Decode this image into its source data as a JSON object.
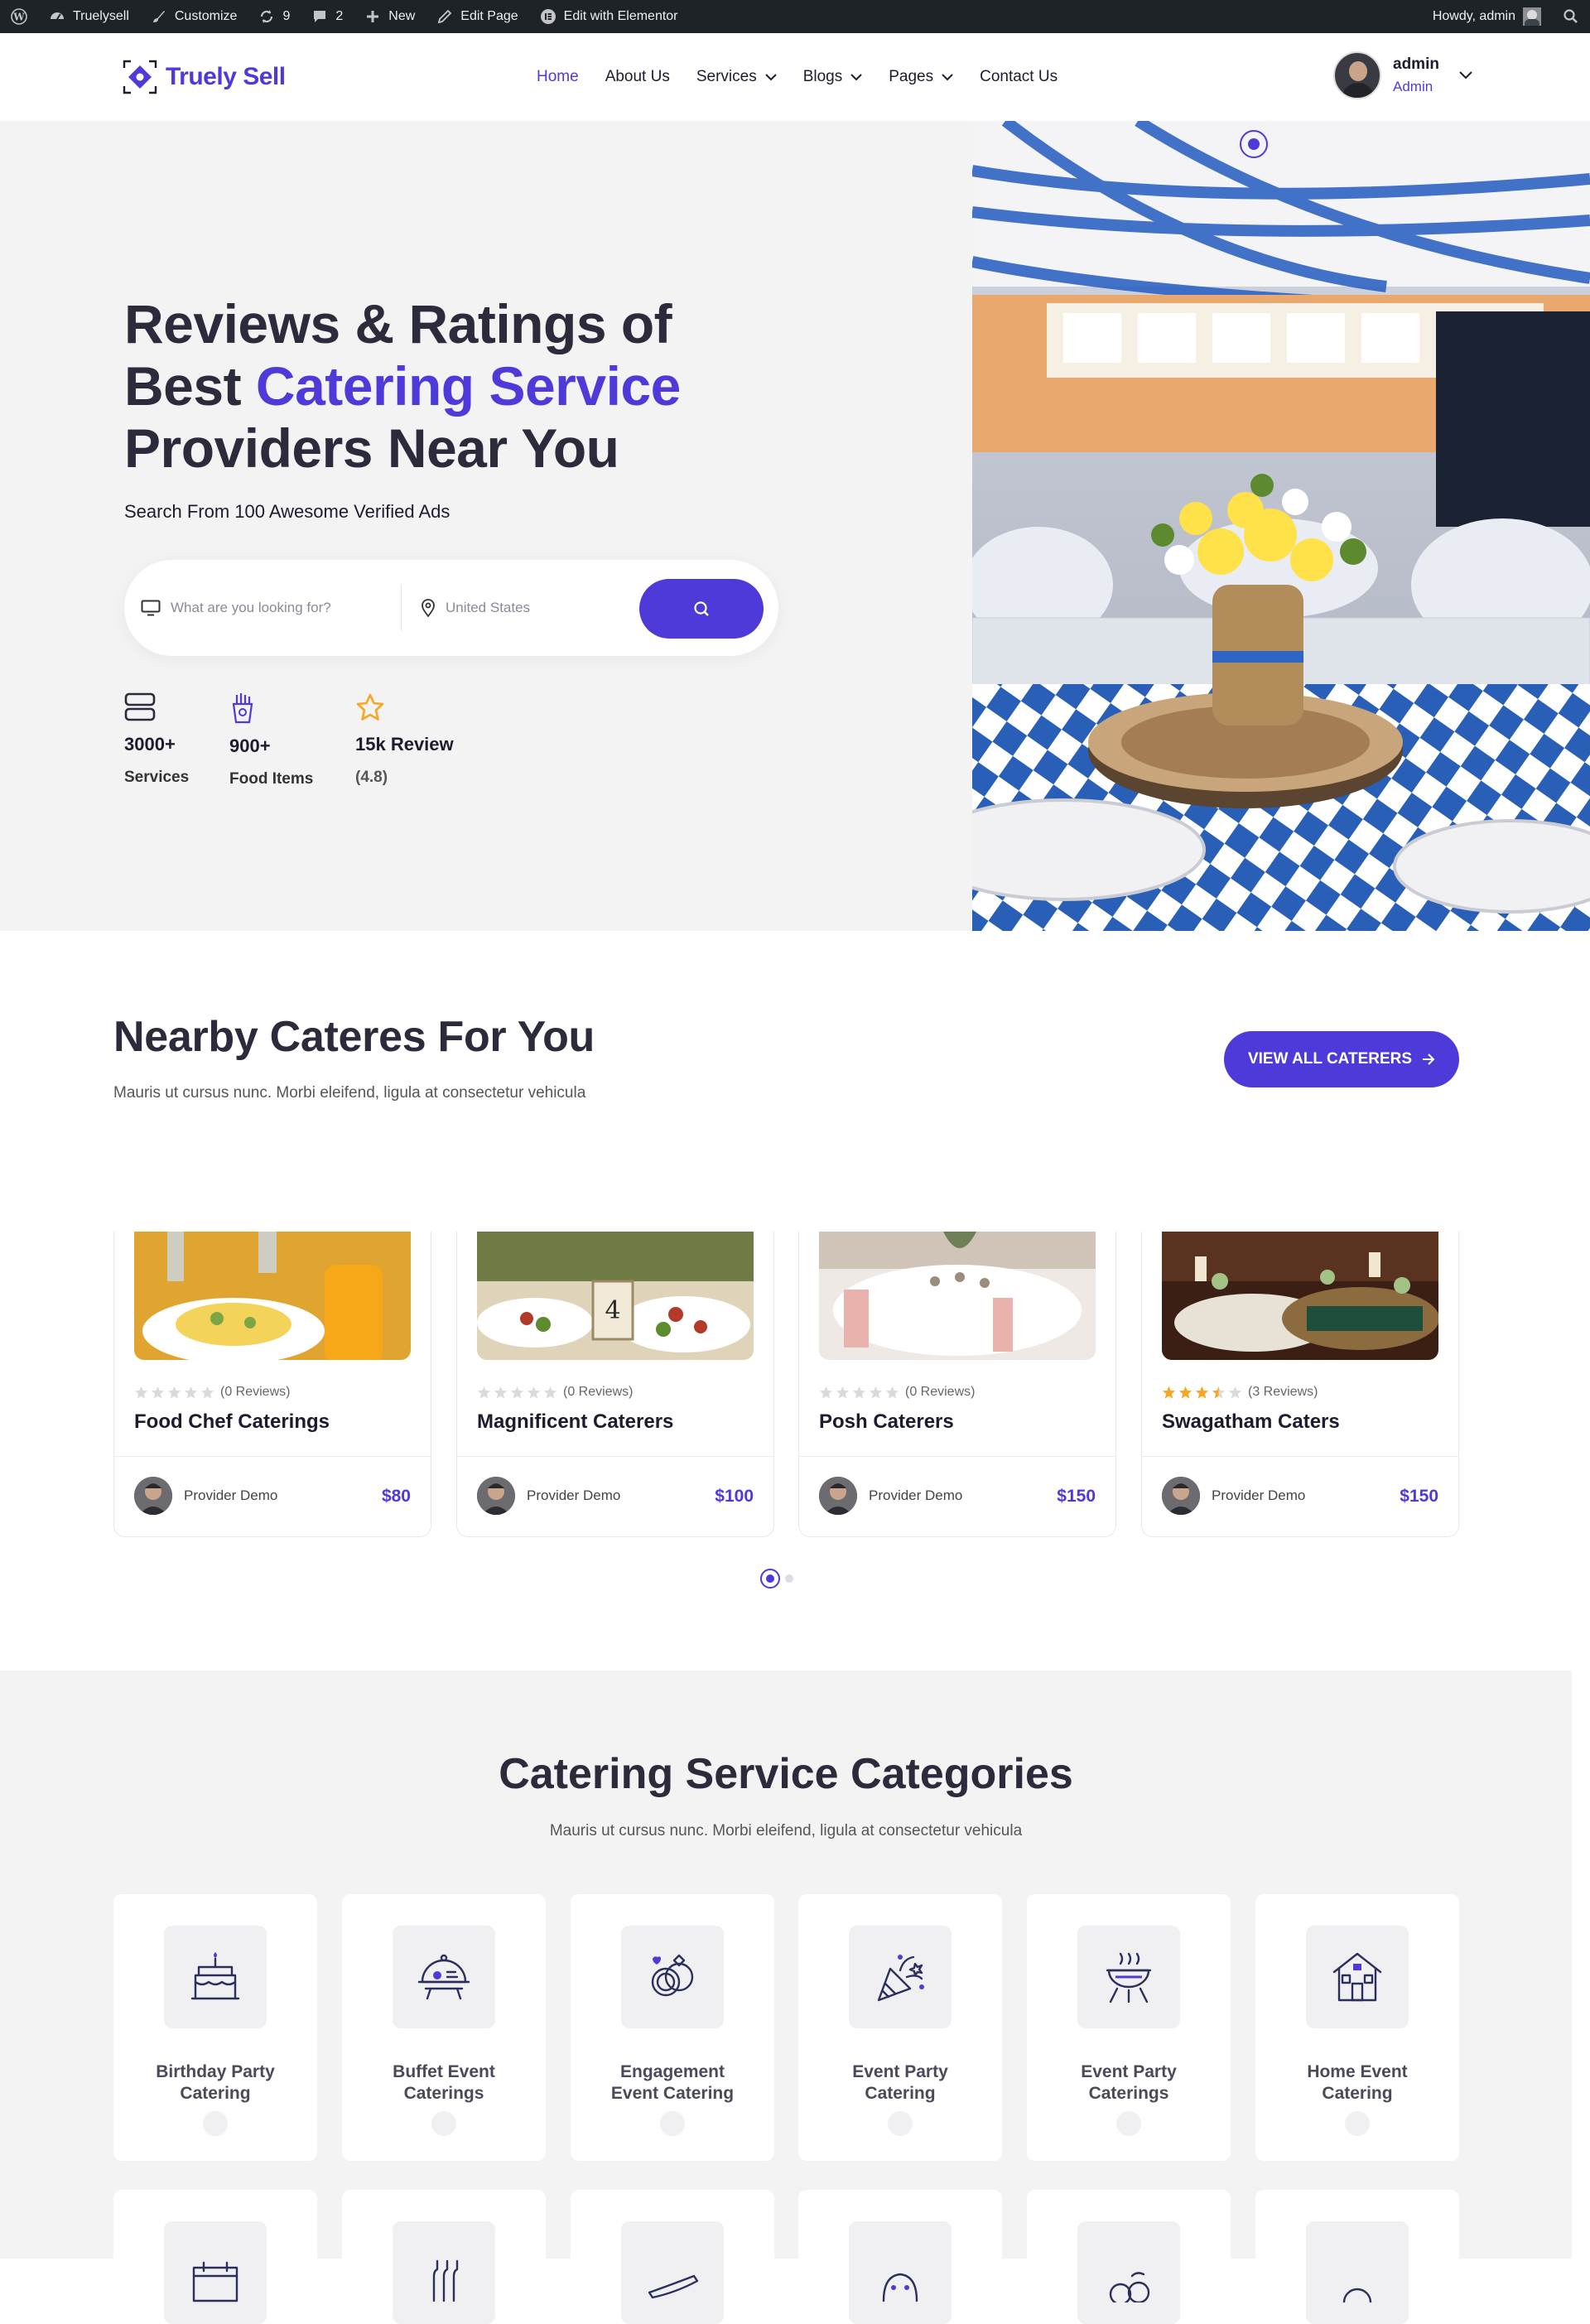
{
  "admin_bar": {
    "site_name": "Truelysell",
    "customize": "Customize",
    "updates": "9",
    "comments": "2",
    "new": "New",
    "edit_page": "Edit Page",
    "edit_elementor": "Edit with Elementor",
    "howdy": "Howdy, admin"
  },
  "header": {
    "logo": "Truely Sell",
    "nav": [
      "Home",
      "About Us",
      "Services",
      "Blogs",
      "Pages",
      "Contact Us"
    ],
    "user_name": "admin",
    "user_role": "Admin"
  },
  "hero": {
    "title_line1": "Reviews & Ratings of",
    "title_best": "Best",
    "title_accent": "Catering Service",
    "title_line3": "Providers Near You",
    "subtitle": "Search From 100 Awesome Verified Ads",
    "search_placeholder": "What are you looking for?",
    "location_placeholder": "United States",
    "stats": [
      {
        "value": "3000+",
        "label": "Services",
        "icon": "server-icon"
      },
      {
        "value": "900+",
        "label": "Food Items",
        "icon": "fries-icon"
      },
      {
        "value": "15k Review",
        "label": "(4.8)",
        "icon": "star-icon"
      }
    ]
  },
  "nearby": {
    "title": "Nearby Cateres For You",
    "subtitle": "Mauris ut cursus nunc. Morbi eleifend, ligula at consectetur vehicula",
    "button": "VIEW ALL CATERERS",
    "cards": [
      {
        "title": "Food Chef Caterings",
        "reviews": "(0 Reviews)",
        "rating": 0,
        "provider": "Provider Demo",
        "price": "$80"
      },
      {
        "title": "Magnificent Caterers",
        "reviews": "(0 Reviews)",
        "rating": 0,
        "provider": "Provider Demo",
        "price": "$100"
      },
      {
        "title": "Posh Caterers",
        "reviews": "(0 Reviews)",
        "rating": 0,
        "provider": "Provider Demo",
        "price": "$150"
      },
      {
        "title": "Swagatham Caters",
        "reviews": "(3 Reviews)",
        "rating": 3.5,
        "provider": "Provider Demo",
        "price": "$150"
      }
    ]
  },
  "categories": {
    "title": "Catering Service Categories",
    "subtitle": "Mauris ut cursus nunc. Morbi eleifend, ligula at consectetur vehicula",
    "items": [
      {
        "line1": "Birthday Party",
        "line2": "Catering",
        "icon": "birthday-cake-icon"
      },
      {
        "line1": "Buffet Event",
        "line2": "Caterings",
        "icon": "food-cloche-icon"
      },
      {
        "line1": "Engagement",
        "line2": "Event Catering",
        "icon": "wedding-rings-icon"
      },
      {
        "line1": "Event Party",
        "line2": "Catering",
        "icon": "party-popper-icon"
      },
      {
        "line1": "Event Party",
        "line2": "Caterings",
        "icon": "barbecue-grill-icon"
      },
      {
        "line1": "Home Event",
        "line2": "Catering",
        "icon": "house-icon"
      }
    ],
    "row2_icons": [
      "calendar-icon",
      "bottles-icon",
      "plane-icon",
      "tiger-icon",
      "fruit-icon",
      "dome-icon"
    ]
  },
  "colors": {
    "accent": "#4e3ad8",
    "star": "#f5a623",
    "admin_bar": "#1d2327"
  }
}
